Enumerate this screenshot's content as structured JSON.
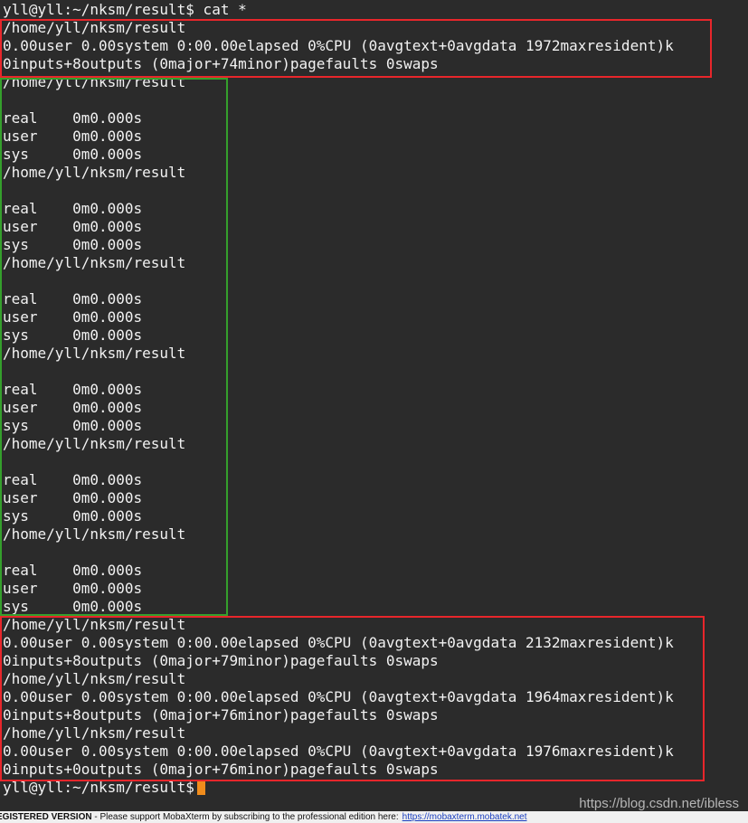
{
  "terminal": {
    "prompt_top": "yll@yll:~/nksm/result$ cat *",
    "red_block_1": [
      "/home/yll/nksm/result",
      "0.00user 0.00system 0:00.00elapsed 0%CPU (0avgtext+0avgdata 1972maxresident)k",
      "0inputs+8outputs (0major+74minor)pagefaults 0swaps"
    ],
    "green_block": [
      "/home/yll/nksm/result",
      "",
      "real    0m0.000s",
      "user    0m0.000s",
      "sys     0m0.000s",
      "/home/yll/nksm/result",
      "",
      "real    0m0.000s",
      "user    0m0.000s",
      "sys     0m0.000s",
      "/home/yll/nksm/result",
      "",
      "real    0m0.000s",
      "user    0m0.000s",
      "sys     0m0.000s",
      "/home/yll/nksm/result",
      "",
      "real    0m0.000s",
      "user    0m0.000s",
      "sys     0m0.000s",
      "/home/yll/nksm/result",
      "",
      "real    0m0.000s",
      "user    0m0.000s",
      "sys     0m0.000s",
      "/home/yll/nksm/result",
      "",
      "real    0m0.000s",
      "user    0m0.000s",
      "sys     0m0.000s"
    ],
    "red_block_2": [
      "/home/yll/nksm/result",
      "0.00user 0.00system 0:00.00elapsed 0%CPU (0avgtext+0avgdata 2132maxresident)k",
      "0inputs+8outputs (0major+79minor)pagefaults 0swaps",
      "/home/yll/nksm/result",
      "0.00user 0.00system 0:00.00elapsed 0%CPU (0avgtext+0avgdata 1964maxresident)k",
      "0inputs+8outputs (0major+76minor)pagefaults 0swaps",
      "/home/yll/nksm/result",
      "0.00user 0.00system 0:00.00elapsed 0%CPU (0avgtext+0avgdata 1976maxresident)k",
      "0inputs+0outputs (0major+76minor)pagefaults 0swaps"
    ],
    "prompt_bottom": "yll@yll:~/nksm/result$"
  },
  "watermark": "https://blog.csdn.net/ibless",
  "status_bar": {
    "registered": "EGISTERED VERSION",
    "message": " -  Please support MobaXterm by subscribing to the professional edition here:",
    "link": "https://mobaxterm.mobatek.net"
  },
  "colors": {
    "background": "#2b2b2b",
    "text": "#f2f2f2",
    "highlight_red": "#e8262b",
    "highlight_green": "#35a02c",
    "cursor": "#f08c1c"
  }
}
